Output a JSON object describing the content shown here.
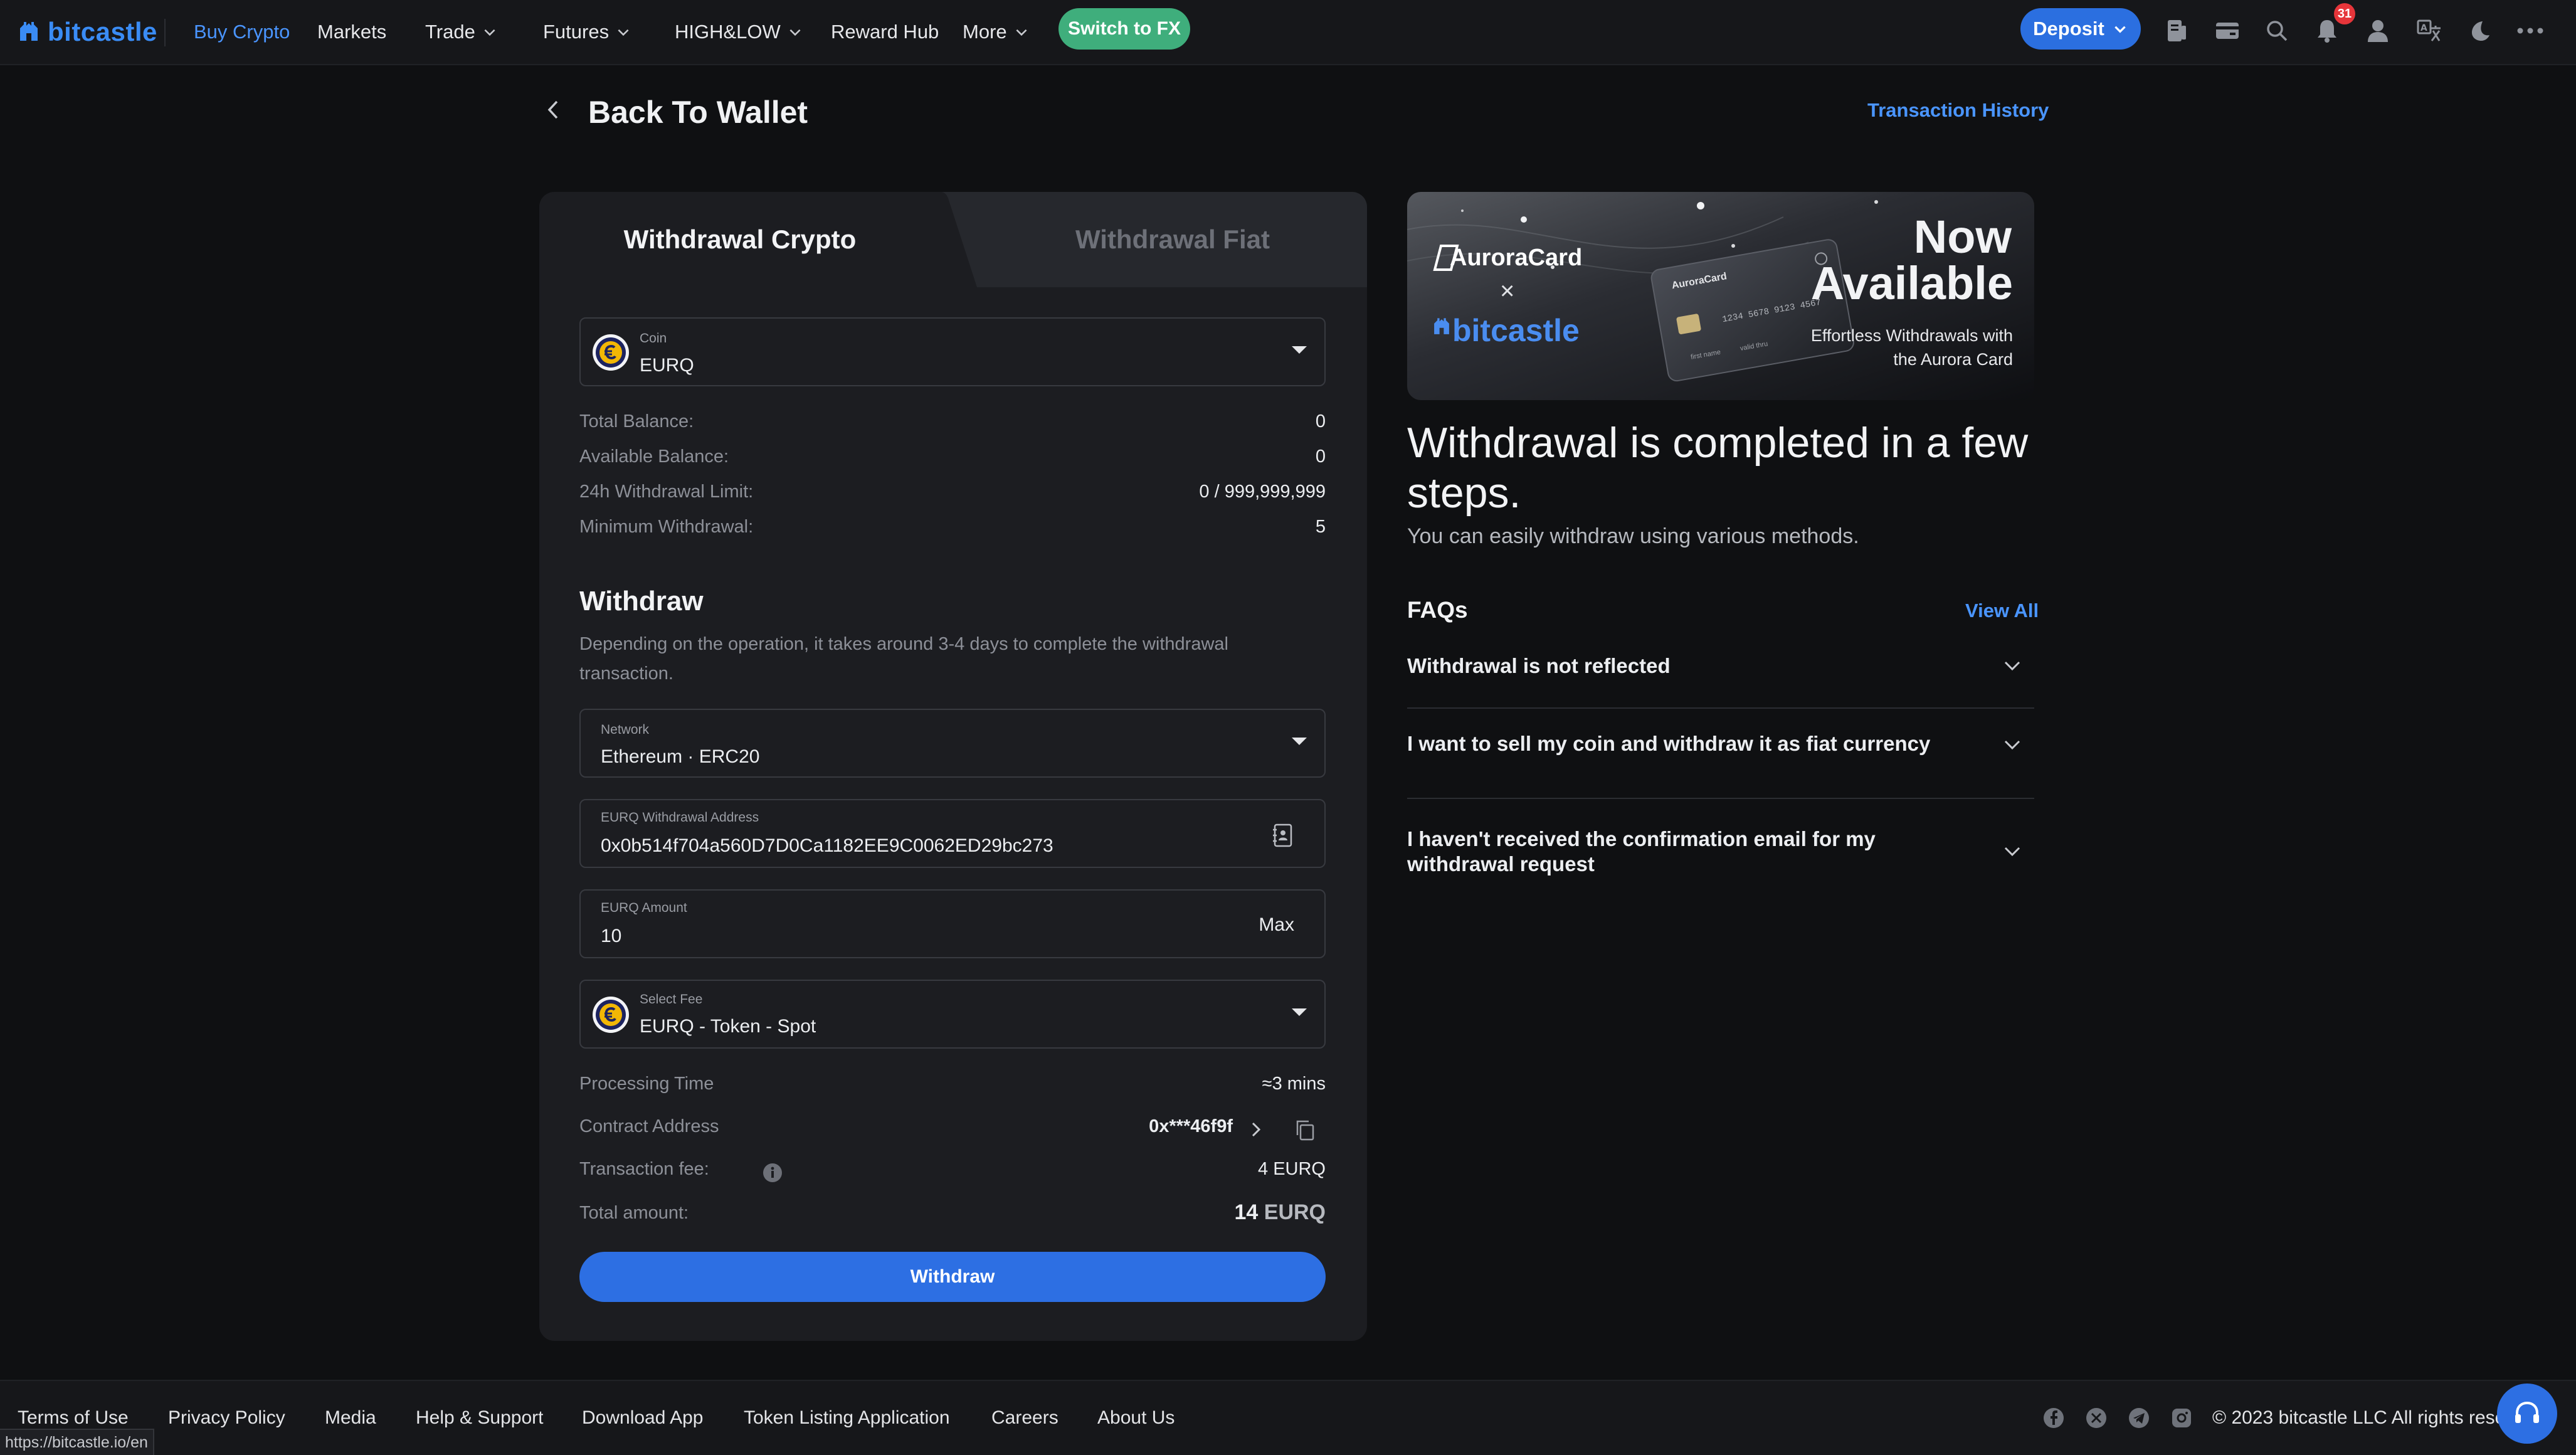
{
  "nav": {
    "logo": "bitcastle",
    "items": [
      {
        "label": "Buy Crypto",
        "active": true
      },
      {
        "label": "Markets"
      },
      {
        "label": "Trade",
        "dropdown": true
      },
      {
        "label": "Futures",
        "dropdown": true
      },
      {
        "label": "HIGH&LOW",
        "dropdown": true
      },
      {
        "label": "Reward Hub"
      },
      {
        "label": "More",
        "dropdown": true
      }
    ],
    "switch_fx": "Switch to FX",
    "deposit": "Deposit",
    "notification_count": "31",
    "icons": [
      "orders-icon",
      "wallet-icon",
      "search-icon",
      "bell-icon",
      "user-icon",
      "language-icon",
      "moon-icon",
      "more-dots-icon"
    ]
  },
  "header": {
    "back_label": "Back To Wallet",
    "history_link": "Transaction History"
  },
  "tabs": {
    "crypto": "Withdrawal Crypto",
    "fiat": "Withdrawal Fiat"
  },
  "coin": {
    "label": "Coin",
    "value": "EURQ"
  },
  "balances": [
    {
      "label": "Total Balance:",
      "value": "0"
    },
    {
      "label": "Available Balance:",
      "value": "0"
    },
    {
      "label": "24h Withdrawal Limit:",
      "value": "0 / 999,999,999"
    },
    {
      "label": "Minimum Withdrawal:",
      "value": "5"
    }
  ],
  "withdraw": {
    "title": "Withdraw",
    "description": "Depending on the operation, it takes around 3-4 days to complete the withdrawal transaction."
  },
  "network": {
    "label": "Network",
    "value": "Ethereum · ERC20"
  },
  "address": {
    "label": "EURQ Withdrawal Address",
    "value": "0x0b514f704a560D7D0Ca1182EE9C0062ED29bc273"
  },
  "amount": {
    "label": "EURQ Amount",
    "value": "10",
    "max": "Max"
  },
  "fee": {
    "label": "Select Fee",
    "value": "EURQ - Token - Spot"
  },
  "summary": {
    "processing_label": "Processing Time",
    "processing_value": "≈3 mins",
    "contract_label": "Contract Address",
    "contract_value": "0x***46f9f",
    "txfee_label": "Transaction fee:",
    "txfee_value": "4 EURQ",
    "total_label": "Total amount:",
    "total_number": "14",
    "total_unit": "EURQ"
  },
  "withdraw_button": "Withdraw",
  "banner": {
    "brand": "AuroraCard",
    "partner": "bitcastle",
    "now": "Now",
    "available": "Available",
    "sub": "Effortless Withdrawals with the Aurora Card",
    "card_brand": "AuroraCard",
    "card_number": "1234 5678 9123 4567",
    "card_name": "first name",
    "card_valid": "valid thru"
  },
  "info": {
    "headline": "Withdrawal is completed in a few steps.",
    "sub": "You can easily withdraw using various methods."
  },
  "faqs": {
    "title": "FAQs",
    "view_all": "View All",
    "items": [
      "Withdrawal is not reflected",
      "I want to sell my coin and withdraw it as fiat currency",
      "I haven't received the confirmation email for my withdrawal request"
    ]
  },
  "footer": {
    "links": [
      "Terms of Use",
      "Privacy Policy",
      "Media",
      "Help & Support",
      "Download App",
      "Token Listing Application",
      "Careers",
      "About Us"
    ],
    "social_icons": [
      "facebook-icon",
      "x-icon",
      "telegram-icon",
      "instagram-icon"
    ],
    "copyright": "© 2023 bitcastle LLC All rights reserved"
  },
  "status_url": "https://bitcastle.io/en",
  "colors": {
    "background": "#0f1012",
    "panel": "#1c1d21",
    "accent": "#2d6fe3",
    "link": "#4a95ff",
    "switch_fx": "#3fae7c",
    "badge": "#e6353a"
  }
}
